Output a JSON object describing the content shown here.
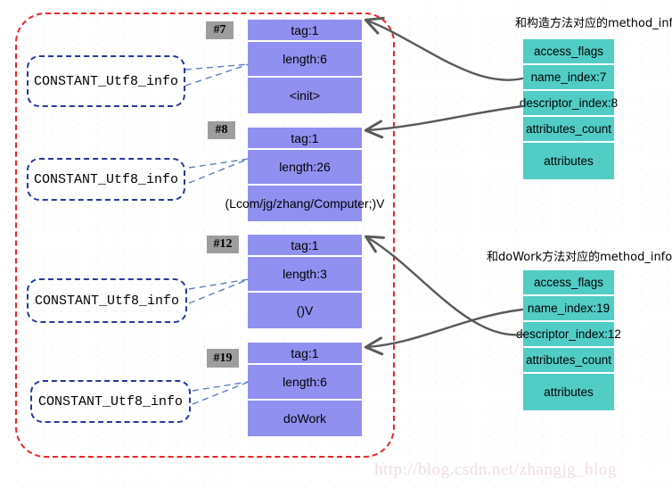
{
  "diagram": {
    "watermark": "http://blog.csdn.net/zhangjg_blog",
    "captions": {
      "constructor_method_info": "和构造方法对应的method_info",
      "dowork_method_info": "和doWork方法对应的method_info"
    },
    "constant_pool_label": "CONSTANT_Utf8_info",
    "entries": [
      {
        "index_tag": "#7",
        "rows": [
          "tag:1",
          "length:6",
          "<init>"
        ],
        "left_label": "CONSTANT_Utf8_info"
      },
      {
        "index_tag": "#8",
        "rows": [
          "tag:1",
          "length:26",
          "(Lcom/jg/zhang/Computer;)V"
        ],
        "left_label": "CONSTANT_Utf8_info"
      },
      {
        "index_tag": "#12",
        "rows": [
          "tag:1",
          "length:3",
          "()V"
        ],
        "left_label": "CONSTANT_Utf8_info"
      },
      {
        "index_tag": "#19",
        "rows": [
          "tag:1",
          "length:6",
          "doWork"
        ],
        "left_label": "CONSTANT_Utf8_info"
      }
    ],
    "method_infos": [
      {
        "caption": "和构造方法对应的method_info",
        "rows": [
          "access_flags",
          "name_index:7",
          "descriptor_index:8",
          "attributes_count",
          "attributes"
        ]
      },
      {
        "caption": "和doWork方法对应的method_info",
        "rows": [
          "access_flags",
          "name_index:19",
          "descriptor_index:12",
          "attributes_count",
          "attributes"
        ]
      }
    ],
    "colors": {
      "constant_pool_fill": "#9090f0",
      "method_info_fill": "#51cdc5",
      "region_border": "#ee2222",
      "utf8_border": "#26389b",
      "index_tag_fill": "#9d9d9d",
      "arrow": "#595959",
      "watermark": "#f0dede"
    }
  }
}
